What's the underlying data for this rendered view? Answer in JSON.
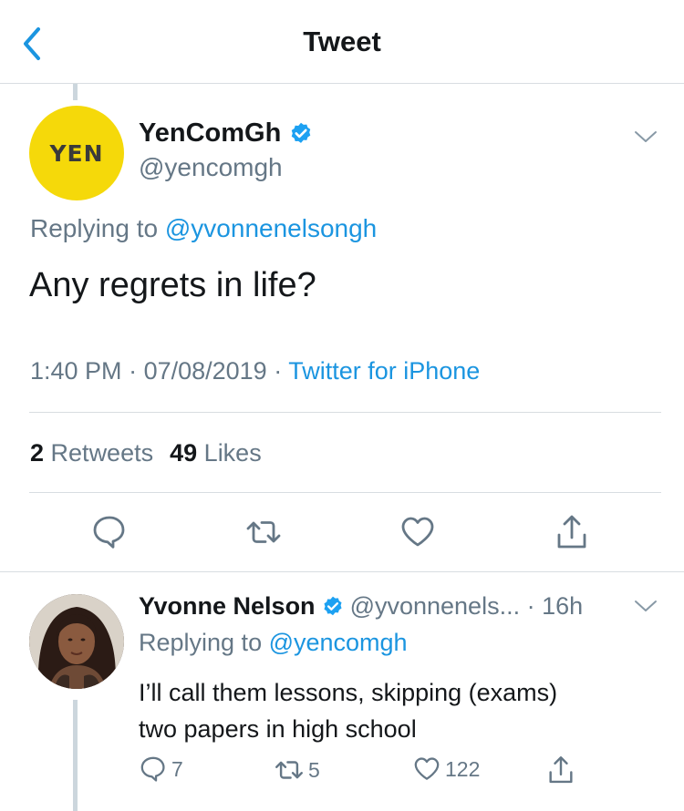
{
  "header": {
    "title": "Tweet"
  },
  "main_tweet": {
    "avatar_text": "YEN",
    "name": "YenComGh",
    "handle": "@yencomgh",
    "replying_prefix": "Replying to ",
    "replying_handle": "@yvonnenelsongh",
    "text": "Any regrets in life?",
    "time": "1:40 PM",
    "separator": " · ",
    "date": "07/08/2019",
    "source": "Twitter for iPhone",
    "retweets_count": "2",
    "retweets_label": "Retweets",
    "likes_count": "49",
    "likes_label": "Likes"
  },
  "reply": {
    "name": "Yvonne Nelson",
    "handle_time": "@yvonnenels... · 16h",
    "replying_prefix": "Replying to ",
    "replying_handle": "@yencomgh",
    "text_line1": "I’ll call them lessons, skipping (exams)",
    "text_line2": "two papers in high school",
    "reply_count": "7",
    "retweet_count": "5",
    "like_count": "122"
  },
  "icons": {
    "back": "chevron-left-icon",
    "verified": "verified-badge-icon",
    "more": "chevron-down-icon",
    "reply": "comment-bubble-icon",
    "retweet": "retweet-icon",
    "like": "heart-icon",
    "share": "share-icon"
  },
  "colors": {
    "accent": "#1b95e0",
    "secondary_text": "#657786",
    "avatar_yellow": "#f5d90a"
  }
}
